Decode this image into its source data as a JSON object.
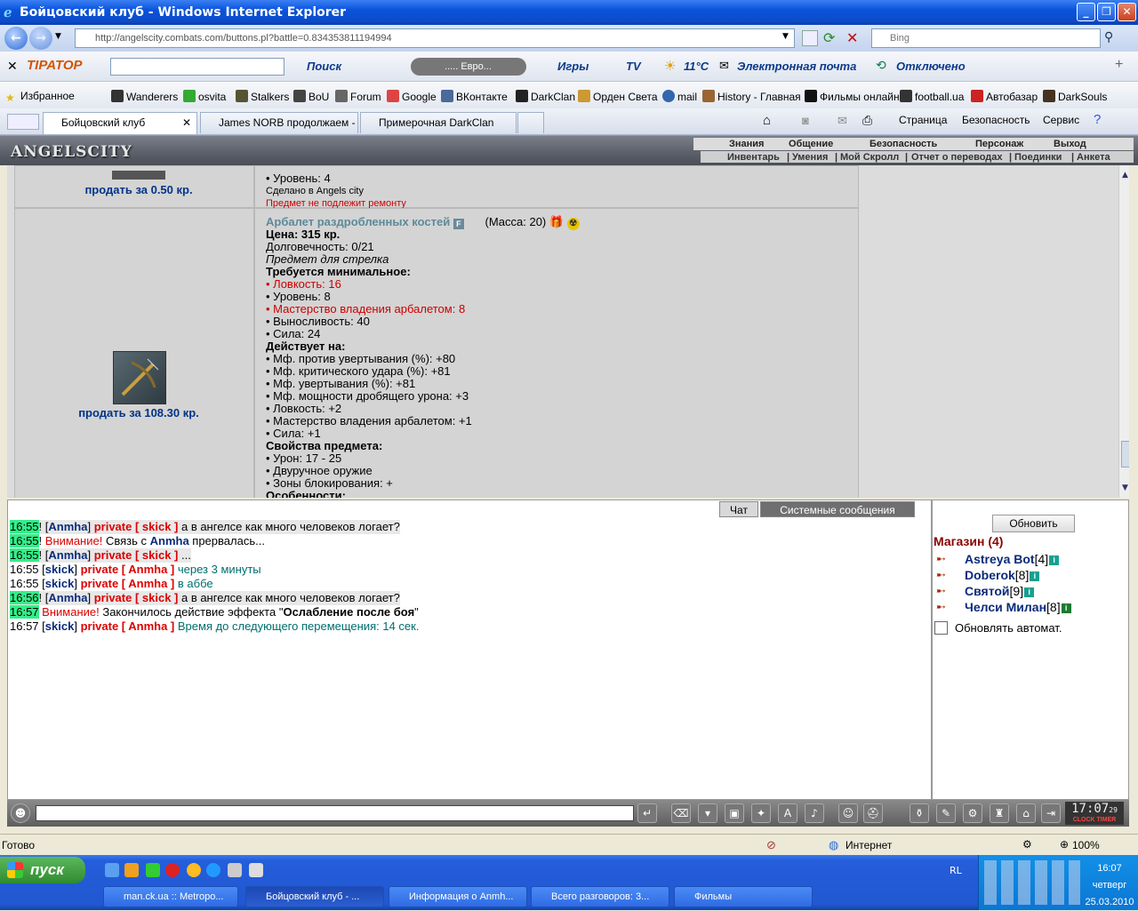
{
  "window": {
    "title": "Бойцовский клуб - Windows Internet Explorer"
  },
  "address": {
    "url": "http://angelscity.combats.com/buttons.pl?battle=0.834353811194994",
    "search_placeholder": "Bing"
  },
  "toolbar": {
    "search_label": "Поиск",
    "euro_label": "..... Евро...",
    "games": "Игры",
    "tv": "TV",
    "weather": "11°C",
    "email": "Электронная почта",
    "status": "Отключено"
  },
  "favorites": {
    "label": "Избранное",
    "items": [
      "Wanderers",
      "osvita",
      "Stalkers",
      "BoU",
      "Forum",
      "Google",
      "ВКонтакте",
      "DarkClan",
      "Орден Света",
      "mail",
      "History - Главная",
      "Фильмы онлайн",
      "football.ua",
      "Автобазар",
      "DarkSouls"
    ]
  },
  "tabs": [
    {
      "label": "Бойцовский клуб"
    },
    {
      "label": "James NORB продолжаем - ..."
    },
    {
      "label": "Примерочная DarkClan"
    }
  ],
  "commandbar": {
    "page": "Страница",
    "safety": "Безопасность",
    "service": "Сервис"
  },
  "game": {
    "logo": "ANGELSCITY",
    "menu_top": [
      "Знания",
      "Общение",
      "Безопасность",
      "Персонаж",
      "Выход"
    ],
    "menu_bottom": [
      "Инвентарь",
      "Умения",
      "Мой Скролл",
      "Отчет о переводах",
      "Поединки",
      "Анкета"
    ],
    "menu_sep": "|"
  },
  "item_prev": {
    "sell": "продать за 0.50 кр.",
    "lines": [
      "• Уровень: 4",
      "Сделано в Angels city",
      "Предмет не подлежит ремонту"
    ]
  },
  "item": {
    "name": "Арбалет раздробленных костей",
    "mass": "(Масса: 20)",
    "sell": "продать за 108.30 кр.",
    "price_label": "Цена:",
    "price": "315 кр.",
    "durability": "Долговечность: 0/21",
    "class": "Предмет для стрелка",
    "req_header": "Требуется минимальное:",
    "requirements": [
      {
        "text": "• Ловкость: 16",
        "red": true
      },
      {
        "text": "• Уровень: 8",
        "red": false
      },
      {
        "text": "• Мастерство владения арбалетом: 8",
        "red": true
      },
      {
        "text": "• Выносливость: 40",
        "red": false
      },
      {
        "text": "• Сила: 24",
        "red": false
      }
    ],
    "effects_header": "Действует на:",
    "effects": [
      "• Мф. против увертывания (%): +80",
      "• Мф. критического удара (%): +81",
      "• Мф. увертывания (%): +81",
      "• Мф. мощности дробящего урона: +3",
      "• Ловкость: +2",
      "• Мастерство владения арбалетом: +1",
      "• Сила: +1"
    ],
    "props_header": "Свойства предмета:",
    "props": [
      "• Урон: 17 - 25",
      "• Двуручное оружие",
      "• Зоны блокирования: +"
    ],
    "features_header": "Особенности:"
  },
  "chat": {
    "tabs": [
      "Чат",
      "Системные сообщения"
    ],
    "lines": [
      {
        "time": "16:55",
        "hl": true,
        "parts": [
          [
            "",
            "!"
          ],
          [
            "b",
            " ["
          ],
          [
            "nk",
            "Anmha"
          ],
          [
            "b",
            "] "
          ],
          [
            "pv",
            "private [ skick ]"
          ],
          [
            "",
            " а в ангелсе как много человеков логает?"
          ]
        ],
        "row": true
      },
      {
        "time": "16:55",
        "hl": true,
        "parts": [
          [
            "",
            "! "
          ],
          [
            "sr",
            "Внимание!"
          ],
          [
            "",
            " Связь с "
          ],
          [
            "nk",
            "Anmha"
          ],
          [
            "",
            " прервалась..."
          ]
        ],
        "row": false
      },
      {
        "time": "16:55",
        "hl": true,
        "parts": [
          [
            "",
            "! "
          ],
          [
            "b",
            "["
          ],
          [
            "nk",
            "Anmha"
          ],
          [
            "b",
            "] "
          ],
          [
            "pv",
            "private [ skick ]"
          ],
          [
            "",
            " ..."
          ]
        ],
        "row": true
      },
      {
        "time": "16:55",
        "hl": false,
        "parts": [
          [
            "b",
            " ["
          ],
          [
            "nk",
            "skick"
          ],
          [
            "b",
            "] "
          ],
          [
            "pv",
            "private [ Anmha ]"
          ],
          [
            "tl",
            " через 3 минуты"
          ]
        ],
        "row": false
      },
      {
        "time": "16:55",
        "hl": false,
        "parts": [
          [
            "b",
            " ["
          ],
          [
            "nk",
            "skick"
          ],
          [
            "b",
            "] "
          ],
          [
            "pv",
            "private [ Anmha ]"
          ],
          [
            "tl",
            " в аббе"
          ]
        ],
        "row": false
      },
      {
        "time": "16:56",
        "hl": true,
        "parts": [
          [
            "",
            "! "
          ],
          [
            "b",
            "["
          ],
          [
            "nk",
            "Anmha"
          ],
          [
            "b",
            "] "
          ],
          [
            "pv",
            "private [ skick ]"
          ],
          [
            "",
            " а в ангелсе как много человеков логает?"
          ]
        ],
        "row": true
      },
      {
        "time": "16:57",
        "hl": true,
        "parts": [
          [
            "",
            ""
          ],
          [
            "sr",
            " Внимание!"
          ],
          [
            "",
            " Закончилось действие эффекта \""
          ],
          [
            "bb",
            "Ослабление после боя"
          ],
          [
            "",
            "\""
          ]
        ],
        "row": false
      },
      {
        "time": "16:57",
        "hl": false,
        "parts": [
          [
            "b",
            " ["
          ],
          [
            "nk",
            "skick"
          ],
          [
            "b",
            "] "
          ],
          [
            "pv",
            "private [ Anmha ]"
          ],
          [
            "tl",
            " Время до следующего перемещения: 14 сек."
          ]
        ],
        "row": false
      }
    ]
  },
  "panel": {
    "refresh": "Обновить",
    "shop": "Магазин (4)",
    "users": [
      {
        "name": "Astreya Bot",
        "level": "[4]"
      },
      {
        "name": "Doberok",
        "level": "[8]"
      },
      {
        "name": "Святой",
        "level": "[9]"
      },
      {
        "name": "Челси Милан",
        "level": "[8]"
      }
    ],
    "auto": "Обновлять автомат."
  },
  "clock": {
    "time": "17:07",
    "sub": "29",
    "labels": "CLOCK TIMER"
  },
  "status": {
    "text": "Готово",
    "zone": "Интернет",
    "zoom": "100%"
  },
  "taskbar": {
    "start": "пуск",
    "tasks": [
      "man.ck.ua :: Metropo...",
      "Бойцовский клуб - ...",
      "Информация о Anmh...",
      "Всего разговоров: 3...",
      "Фильмы"
    ],
    "lang": "RL",
    "time": "16:07",
    "day": "четверг",
    "date": "25.03.2010"
  }
}
